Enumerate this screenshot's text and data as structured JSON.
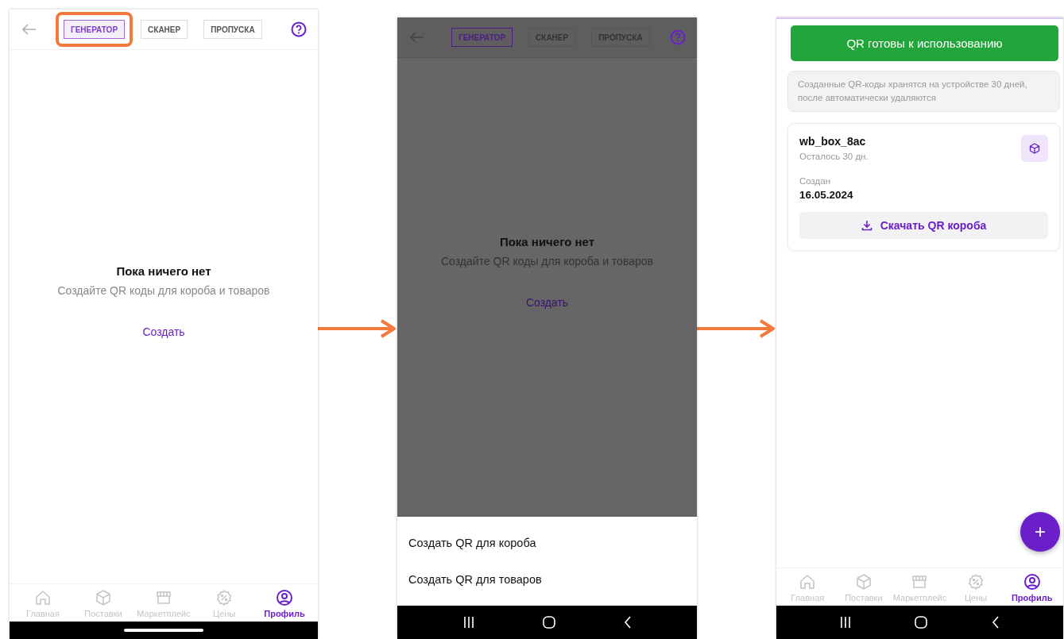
{
  "screens": [
    {
      "kind": "empty",
      "dimmed": false,
      "tabs": [
        {
          "label": "ГЕНЕРАТОР",
          "selected": true,
          "highlighted": true
        },
        {
          "label": "СКАНЕР",
          "selected": false,
          "highlighted": false
        },
        {
          "label": "ПРОПУСКА",
          "selected": false,
          "highlighted": false
        }
      ],
      "empty_title": "Пока ничего нет",
      "empty_text": "Создайте QR коды для короба и товаров",
      "create_link": "Создать",
      "nav": [
        {
          "label": "Главная",
          "selected": false
        },
        {
          "label": "Поставки",
          "selected": false
        },
        {
          "label": "Маркетплейс",
          "selected": false
        },
        {
          "label": "Цены",
          "selected": false
        },
        {
          "label": "Профиль",
          "selected": true
        }
      ],
      "system_bar": {
        "kind": "gesture"
      }
    },
    {
      "kind": "empty",
      "dimmed": true,
      "tabs": [
        {
          "label": "ГЕНЕРАТОР",
          "selected": true,
          "highlighted": false
        },
        {
          "label": "СКАНЕР",
          "selected": false,
          "highlighted": false
        },
        {
          "label": "ПРОПУСКА",
          "selected": false,
          "highlighted": false
        }
      ],
      "empty_title": "Пока ничего нет",
      "empty_text": "Создайте QR коды для короба и товаров",
      "create_link": "Создать",
      "sheet_options": [
        "Создать QR для короба",
        "Создать QR для товаров"
      ],
      "system_bar": {
        "kind": "buttons"
      }
    },
    {
      "kind": "list",
      "toast": "QR готовы к использованию",
      "notice": "Созданные QR-коды хранятся на устройстве 30 дней, после автоматически удаляются",
      "card": {
        "name": "wb_box_8ac",
        "remaining": "Осталось 30 дн.",
        "created_label": "Создан",
        "created_date": "16.05.2024",
        "download": "Скачать QR короба"
      },
      "fab": "+",
      "nav": [
        {
          "label": "Главная",
          "selected": false
        },
        {
          "label": "Поставки",
          "selected": false
        },
        {
          "label": "Маркетплейс",
          "selected": false
        },
        {
          "label": "Цены",
          "selected": false
        },
        {
          "label": "Профиль",
          "selected": true
        }
      ],
      "system_bar": {
        "kind": "buttons"
      }
    }
  ]
}
